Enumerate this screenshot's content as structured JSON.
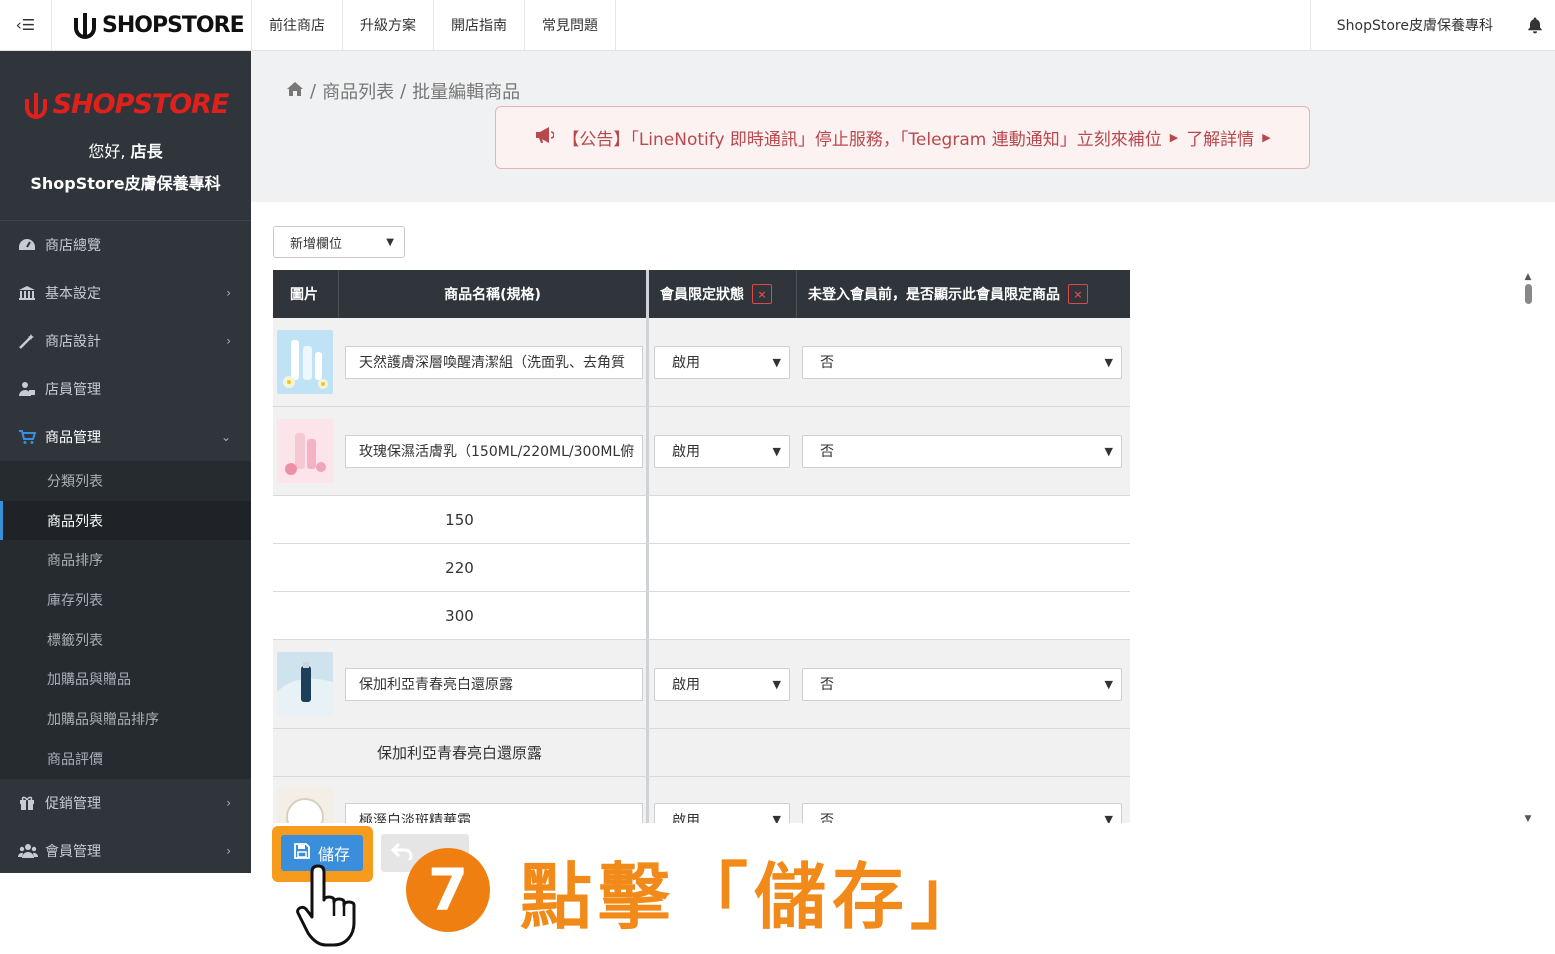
{
  "topbar": {
    "brand": "SHOPSTORE",
    "nav": [
      "前往商店",
      "升級方案",
      "開店指南",
      "常見問題"
    ],
    "store_name": "ShopStore皮膚保養專科"
  },
  "sidebar": {
    "logo": "SHOPSTORE",
    "greeting_prefix": "您好, ",
    "greeting_name": "店長",
    "store_name": "ShopStore皮膚保養專科",
    "items": [
      {
        "label": "商店總覽",
        "icon": "dashboard-icon"
      },
      {
        "label": "基本設定",
        "icon": "bank-icon"
      },
      {
        "label": "商店設計",
        "icon": "magic-wand-icon"
      },
      {
        "label": "店員管理",
        "icon": "user-lock-icon"
      },
      {
        "label": "商品管理",
        "icon": "cart-icon"
      },
      {
        "label": "促銷管理",
        "icon": "gift-icon"
      },
      {
        "label": "會員管理",
        "icon": "users-icon"
      }
    ],
    "sub_items": [
      "分類列表",
      "商品列表",
      "商品排序",
      "庫存列表",
      "標籤列表",
      "加購品與贈品",
      "加購品與贈品排序",
      "商品評價"
    ]
  },
  "breadcrumb": {
    "level1": "商品列表",
    "level2": "批量編輯商品",
    "sep": "/"
  },
  "notice": {
    "text": "【公告】「LineNotify 即時通訊」停止服務，「Telegram 連動通知」立刻來補位",
    "link": "了解詳情"
  },
  "toolbar": {
    "add_column": "新增欄位"
  },
  "table": {
    "headers": [
      "圖片",
      "商品名稱(規格)",
      "會員限定狀態",
      "未登入會員前，是否顯示此會員限定商品"
    ],
    "remove_mark": "×",
    "rows": [
      {
        "name": "天然護膚深層喚醒清潔組（洗面乳、去角質",
        "status": "啟用",
        "show": "否"
      },
      {
        "name": "玫瑰保濕活膚乳（150ML/220ML/300ML俯",
        "status": "啟用",
        "show": "否"
      },
      {
        "variant": "150"
      },
      {
        "variant": "220"
      },
      {
        "variant": "300"
      },
      {
        "name": "保加利亞青春亮白還原露",
        "status": "啟用",
        "show": "否"
      },
      {
        "variant": "保加利亞青春亮白還原露"
      },
      {
        "name": "極溼白淡斑精華霜",
        "status": "啟用",
        "show": "否"
      }
    ]
  },
  "actions": {
    "save": "儲存"
  },
  "annotation": {
    "step": "7",
    "text": "點擊「儲存」"
  },
  "colors": {
    "sidebar_bg": "#2f353b",
    "primary": "#3a8edb",
    "highlight": "#f79b1d",
    "brand_red": "#e0211b",
    "notice_text": "#b9484c"
  }
}
